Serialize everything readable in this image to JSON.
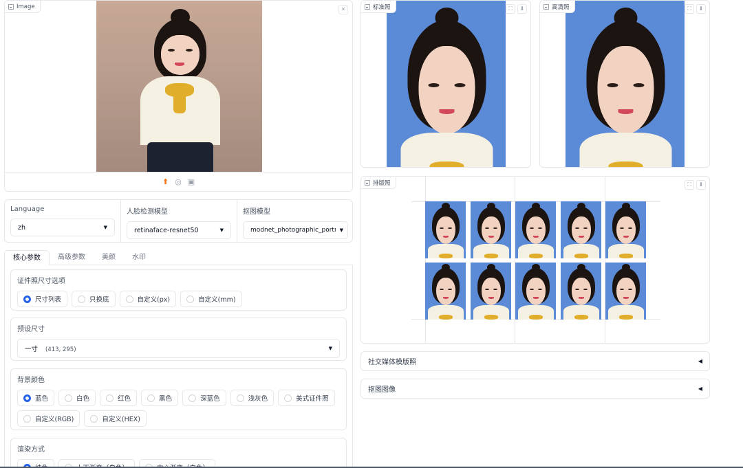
{
  "image_panel": {
    "tag": "Image",
    "close_icon": "close-icon",
    "upload_icons": [
      "upload-icon",
      "webcam-icon",
      "clipboard-icon"
    ]
  },
  "standard_panel": {
    "tag": "标准照"
  },
  "hd_panel": {
    "tag": "高清照"
  },
  "layout_panel": {
    "tag": "排版照",
    "rows": 2,
    "cols": 5
  },
  "models": {
    "language": {
      "label": "Language",
      "value": "zh"
    },
    "face_detect": {
      "label": "人脸检测模型",
      "value": "retinaface-resnet50"
    },
    "matting": {
      "label": "抠图模型",
      "value": "modnet_photographic_portrait"
    }
  },
  "tabs": [
    {
      "label": "核心参数",
      "active": true
    },
    {
      "label": "高级参数",
      "active": false
    },
    {
      "label": "美颜",
      "active": false
    },
    {
      "label": "水印",
      "active": false
    }
  ],
  "size_options": {
    "label": "证件照尺寸选项",
    "options": [
      {
        "label": "尺寸列表",
        "checked": true
      },
      {
        "label": "只换底",
        "checked": false
      },
      {
        "label": "自定义(px)",
        "checked": false
      },
      {
        "label": "自定义(mm)",
        "checked": false
      }
    ]
  },
  "preset_size": {
    "label": "预设尺寸",
    "name": "一寸",
    "dims": "(413, 295)"
  },
  "bg_color": {
    "label": "背景颜色",
    "options": [
      {
        "label": "蓝色",
        "checked": true
      },
      {
        "label": "白色",
        "checked": false
      },
      {
        "label": "红色",
        "checked": false
      },
      {
        "label": "黑色",
        "checked": false
      },
      {
        "label": "深蓝色",
        "checked": false
      },
      {
        "label": "浅灰色",
        "checked": false
      },
      {
        "label": "美式证件照",
        "checked": false
      },
      {
        "label": "自定义(RGB)",
        "checked": false
      },
      {
        "label": "自定义(HEX)",
        "checked": false
      }
    ]
  },
  "render_mode": {
    "label": "渲染方式",
    "options": [
      {
        "label": "纯色",
        "checked": true
      },
      {
        "label": "上下渐变（白色）",
        "checked": false
      },
      {
        "label": "中心渐变（白色）",
        "checked": false
      }
    ]
  },
  "accordions": [
    {
      "label": "社交媒体模版照"
    },
    {
      "label": "抠图图像"
    }
  ],
  "colors": {
    "accent": "#2563eb",
    "photo_bg_blue": "#5b8ad6",
    "upload_accent": "#f97316",
    "border": "#e5e7eb"
  }
}
